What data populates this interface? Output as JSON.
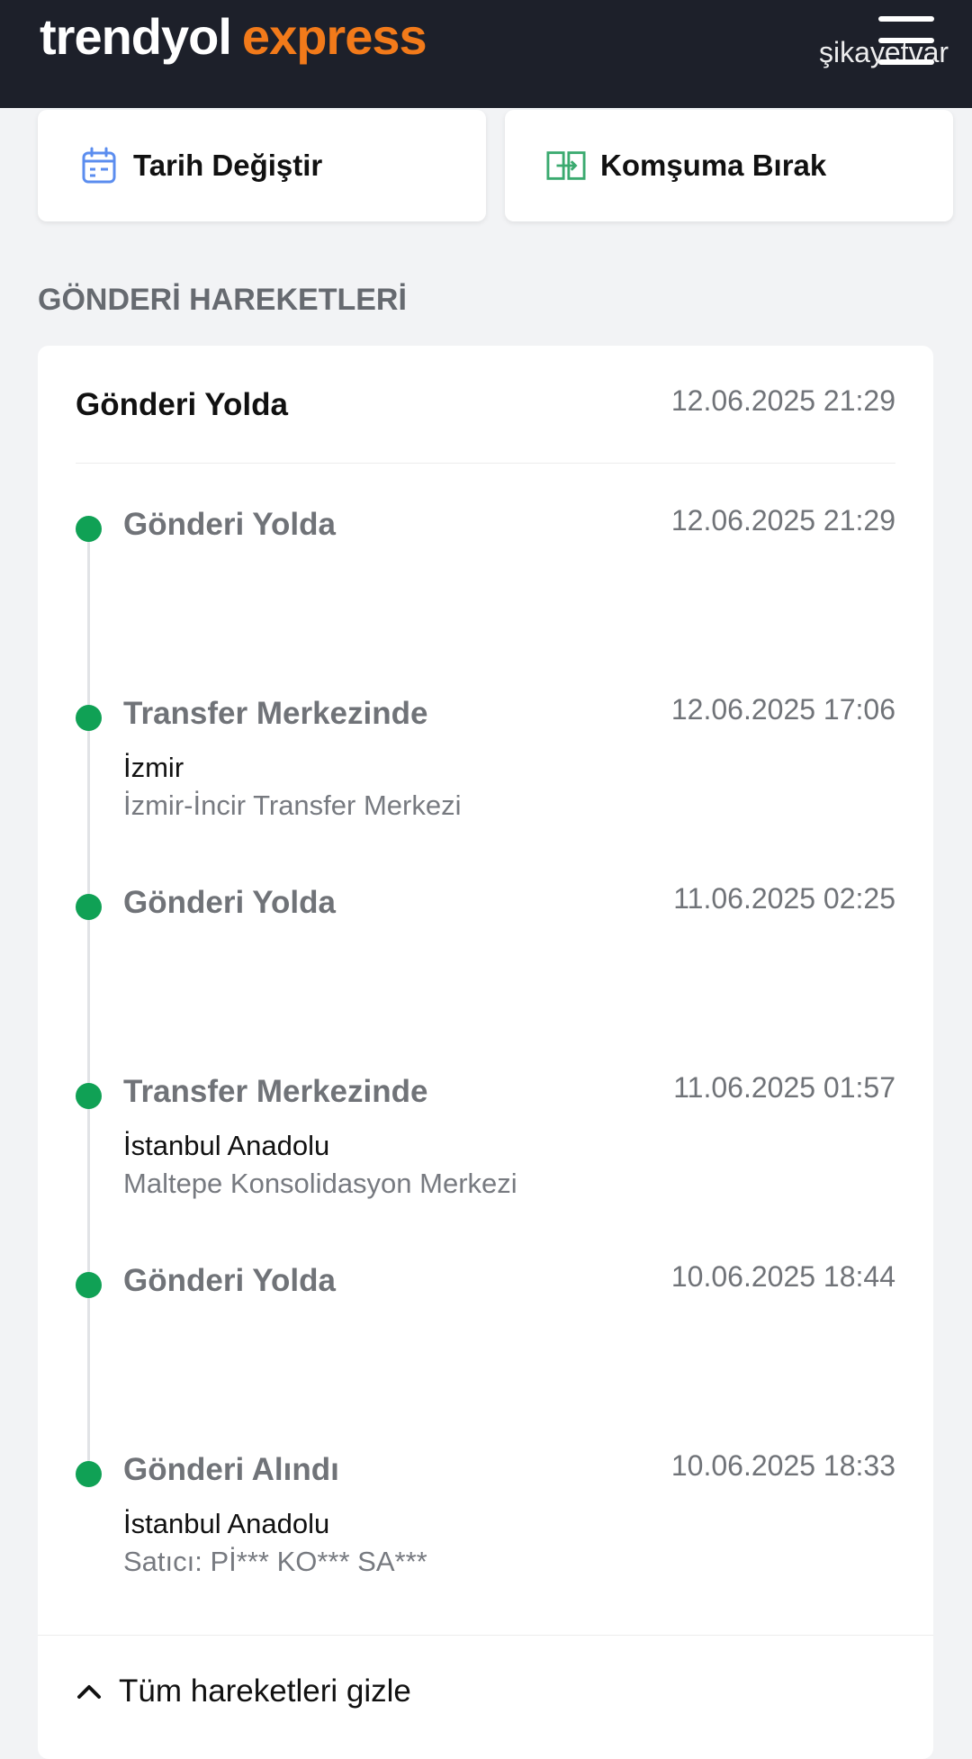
{
  "header": {
    "logo_part1": "trendyol",
    "logo_part2": "express",
    "watermark": "şikayetvar"
  },
  "actions": [
    {
      "label": "Tarih Değiştir",
      "icon": "calendar-icon"
    },
    {
      "label": "Komşuma Bırak",
      "icon": "swap-box-icon"
    }
  ],
  "section_title": "GÖNDERİ HAREKETLERİ",
  "summary": {
    "title": "Gönderi Yolda",
    "date": "12.06.2025 21:29"
  },
  "events": [
    {
      "title": "Gönderi Yolda",
      "date": "12.06.2025 21:29",
      "location": "",
      "detail": ""
    },
    {
      "title": "Transfer Merkezinde",
      "date": "12.06.2025 17:06",
      "location": "İzmir",
      "detail": "İzmir-İncir Transfer Merkezi"
    },
    {
      "title": "Gönderi Yolda",
      "date": "11.06.2025 02:25",
      "location": "",
      "detail": ""
    },
    {
      "title": "Transfer Merkezinde",
      "date": "11.06.2025 01:57",
      "location": "İstanbul Anadolu",
      "detail": "Maltepe Konsolidasyon Merkezi"
    },
    {
      "title": "Gönderi Yolda",
      "date": "10.06.2025 18:44",
      "location": "",
      "detail": ""
    },
    {
      "title": "Gönderi Alındı",
      "date": "10.06.2025 18:33",
      "location": "İstanbul Anadolu",
      "detail": "Satıcı: Pİ*** KO*** SA***"
    }
  ],
  "toggle_label": "Tüm hareketleri gizle",
  "colors": {
    "header_bg": "#1d202a",
    "brand_orange": "#f27a1a",
    "status_green": "#10a155"
  }
}
